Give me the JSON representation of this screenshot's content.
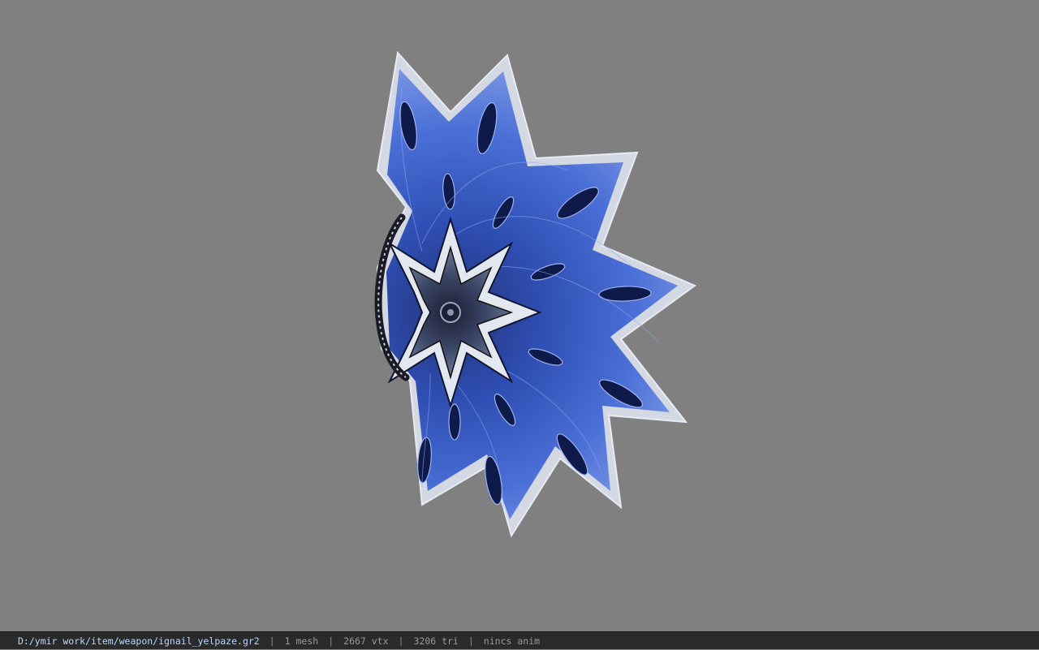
{
  "viewer": {
    "background_color": "#808080",
    "model": {
      "name": "ignail_yelpaze",
      "icon": "bladed-fan-weapon-model",
      "colors": {
        "blade_blue": "#3f62c9",
        "blade_dark": "#0d1a4a",
        "edge_silver": "#d9dde6",
        "handle": "#1a1a24"
      }
    }
  },
  "statusbar": {
    "path": "D:/ymir work/item/weapon/ignail_yelpaze.gr2",
    "mesh": "1 mesh",
    "vertices": "2667 vtx",
    "triangles": "3206 tri",
    "anim": "nincs anim"
  }
}
